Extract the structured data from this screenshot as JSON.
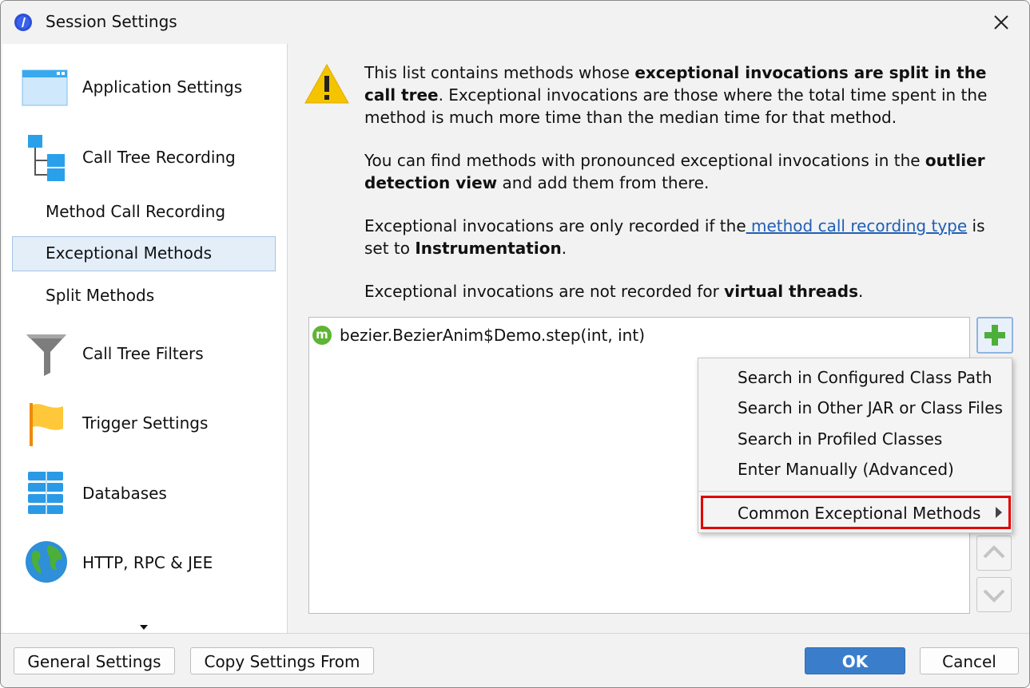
{
  "window": {
    "title": "Session Settings"
  },
  "sidebar": {
    "items": [
      {
        "label": "Application Settings",
        "icon": "application-settings-icon"
      },
      {
        "label": "Call Tree Recording",
        "icon": "call-tree-icon"
      },
      {
        "label": "Method Call Recording"
      },
      {
        "label": "Exceptional Methods",
        "selected": true
      },
      {
        "label": "Split Methods"
      },
      {
        "label": "Call Tree Filters",
        "icon": "funnel-icon"
      },
      {
        "label": "Trigger Settings",
        "icon": "flag-icon"
      },
      {
        "label": "Databases",
        "icon": "database-icon"
      },
      {
        "label": "HTTP, RPC & JEE",
        "icon": "globe-icon"
      }
    ]
  },
  "content": {
    "p1_text1": "This list contains methods whose ",
    "p1_bold": "exceptional invocations are split in the call tree",
    "p1_text2": ". Exceptional invocations are those where the total time spent in the method is much more time than the median time for that method.",
    "p2_text1": "You can find methods with pronounced exceptional invocations in the ",
    "p2_bold": "outlier detection view",
    "p2_text2": " and add them from there.",
    "p3_text1": "Exceptional invocations are only recorded if the",
    "p3_link": " method call recording type",
    "p3_text2": " is set to ",
    "p3_bold": "Instrumentation",
    "p3_text3": ".",
    "p4_text1": "Exceptional invocations are not recorded for ",
    "p4_bold": "virtual threads",
    "p4_text2": "."
  },
  "list": {
    "rows": [
      {
        "badge": "m",
        "text": "bezier.BezierAnim$Demo.step(int, int)"
      }
    ]
  },
  "popup_menu": {
    "items": [
      "Search in Configured Class Path",
      "Search in Other JAR or Class Files",
      "Search in Profiled Classes",
      "Enter Manually (Advanced)"
    ],
    "submenu": "Common Exceptional Methods"
  },
  "footer": {
    "general_settings": "General Settings",
    "copy_settings": "Copy Settings From",
    "ok": "OK",
    "cancel": "Cancel"
  },
  "colors": {
    "accent": "#3a7ecb",
    "selection": "#e3eef9",
    "highlight_border": "#e00000",
    "add_green": "#5eb534",
    "link": "#1f5fb5"
  }
}
